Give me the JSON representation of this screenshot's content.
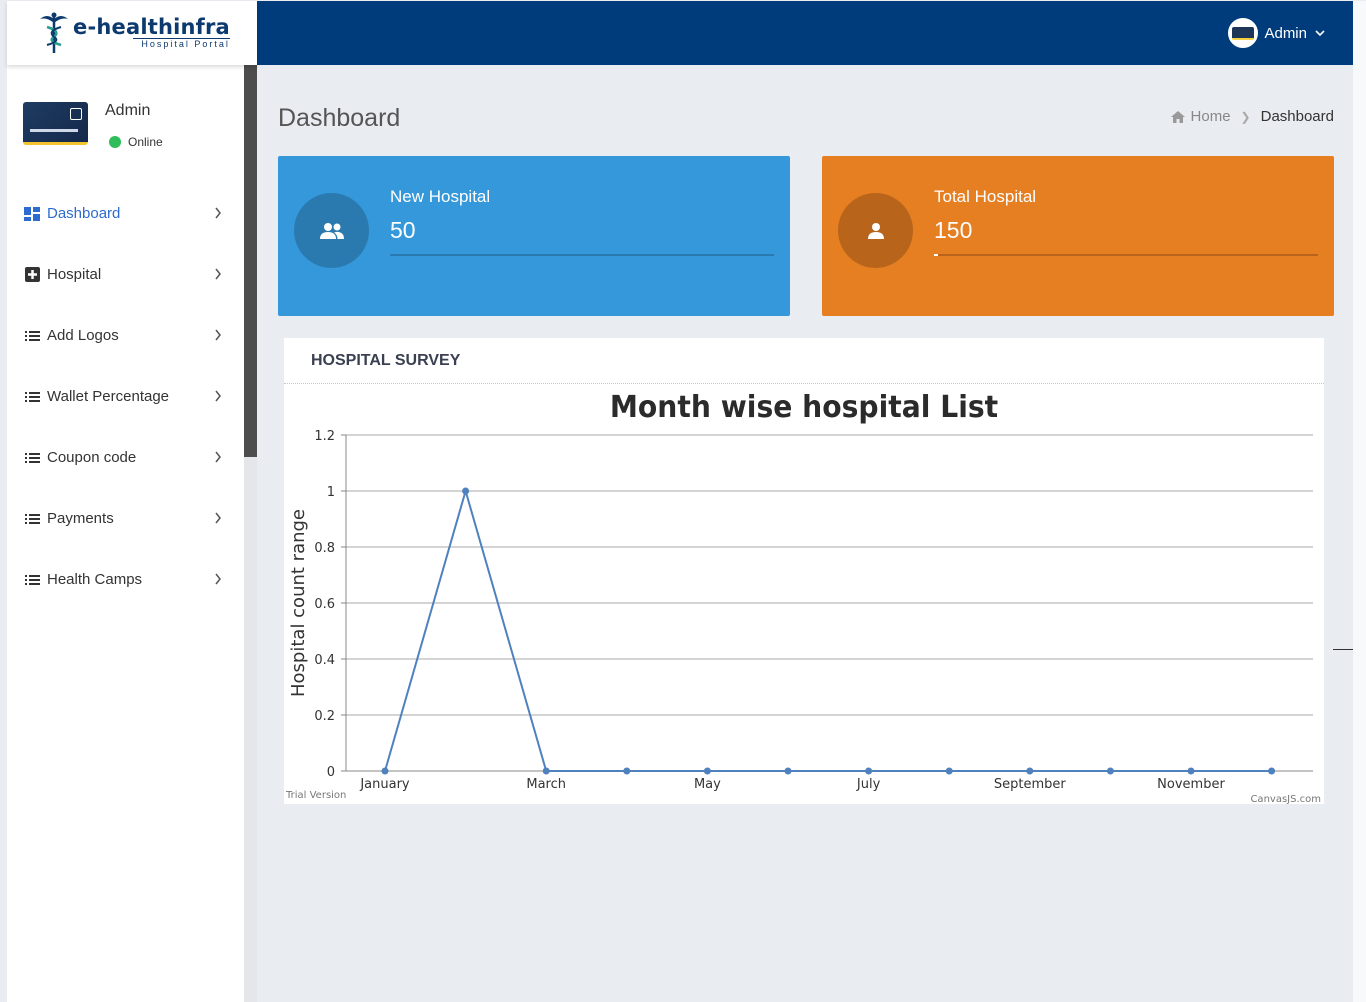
{
  "brand": {
    "name": "e-healthinfra",
    "tagline": "Hospital Portal"
  },
  "topbar": {
    "user_label": "Admin"
  },
  "profile": {
    "name": "Admin",
    "status": "Online"
  },
  "menu": [
    {
      "label": "Dashboard",
      "icon": "dashboard-icon",
      "active": true
    },
    {
      "label": "Hospital",
      "icon": "plus-square-icon",
      "active": false
    },
    {
      "label": "Add Logos",
      "icon": "list-icon",
      "active": false
    },
    {
      "label": "Wallet Percentage",
      "icon": "list-icon",
      "active": false
    },
    {
      "label": "Coupon code",
      "icon": "list-icon",
      "active": false
    },
    {
      "label": "Payments",
      "icon": "list-icon",
      "active": false
    },
    {
      "label": "Health Camps",
      "icon": "list-icon",
      "active": false
    }
  ],
  "page": {
    "title": "Dashboard"
  },
  "breadcrumb": {
    "home": "Home",
    "current": "Dashboard"
  },
  "stats": [
    {
      "label": "New Hospital",
      "value": "50",
      "icon": "users-icon",
      "color": "#3498db",
      "progress": 0
    },
    {
      "label": "Total Hospital",
      "value": "150",
      "icon": "user-icon",
      "color": "#e67e22",
      "progress": 0.01
    }
  ],
  "survey": {
    "title": "HOSPITAL SURVEY",
    "watermark_left": "Trial Version",
    "watermark_right": "CanvasJS.com"
  },
  "colors": {
    "topbar": "#003c7c",
    "accent": "#2d6bd1",
    "online": "#2ebd59",
    "line": "#4f81bd"
  },
  "chart_data": {
    "type": "line",
    "title": "Month wise hospital List",
    "xlabel": "",
    "ylabel": "Hospital count range",
    "x": [
      "January",
      "February",
      "March",
      "April",
      "May",
      "June",
      "July",
      "August",
      "September",
      "October",
      "November",
      "December"
    ],
    "x_tick_labels": [
      "January",
      "March",
      "May",
      "July",
      "September",
      "November"
    ],
    "series": [
      {
        "values": [
          0,
          1,
          0,
          0,
          0,
          0,
          0,
          0,
          0,
          0,
          0,
          0
        ]
      }
    ],
    "ylim": [
      0,
      1.2
    ],
    "yticks": [
      0,
      0.2,
      0.4,
      0.6,
      0.8,
      1,
      1.2
    ],
    "grid": true,
    "legend": "none"
  }
}
